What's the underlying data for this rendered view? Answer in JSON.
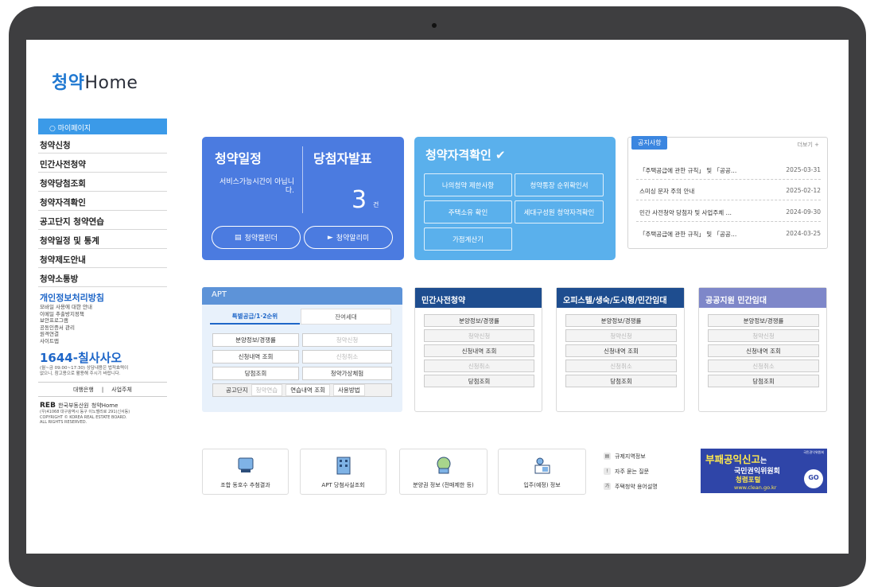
{
  "logo": {
    "prefix": "청약",
    "suffix": "Home"
  },
  "sidebar": {
    "mypage": "마이페이지",
    "items": [
      "청약신청",
      "민간사전청약",
      "청약당첨조회",
      "청약자격확인",
      "공고단지 청약연습",
      "청약일정 및 통계",
      "청약제도안내",
      "청약소통방"
    ],
    "privacy_title": "개인정보처리방침",
    "privacy_links": [
      "모바일 사용에 대한 안내",
      "이메일 추출방지정책",
      "보안프로그램",
      "공동인증서 관리",
      "원격연결",
      "사이트맵"
    ],
    "phone": "1644-칠사사오",
    "hours": [
      "(월~금 09:00~17:30) 상담내용은 법적효력이",
      "없으니, 참고용으로 활용해 주시기 바랍니다."
    ],
    "links": [
      "대행은행",
      "사업주체"
    ],
    "org": "REB",
    "org_name": "한국부동산원",
    "copyright": [
      "(우)41068 대구광역시 동구 이노밸리로 291(신서동)",
      "COPYRIGHT © KOREA REAL ESTATE BOARD.",
      "ALL RIGHTS RESERVED."
    ]
  },
  "schedule": {
    "title": "청약일정",
    "winner_title": "당첨자발표",
    "message": "서비스가능시간이 아닙니다.",
    "count": "3",
    "count_unit": "건",
    "calendar_btn": "청약캘린더",
    "alarm_btn": "청약알리미"
  },
  "qualification": {
    "title": "청약자격확인",
    "buttons": [
      "나의청약 제한사항",
      "청약통장 순위확인서",
      "주택소유 확인",
      "세대구성원 청약자격확인",
      "가점계산기"
    ]
  },
  "notice": {
    "tag": "공지사항",
    "more": "더보기",
    "items": [
      {
        "title": "「주택공급에 관한 규칙」 및 「공공…",
        "date": "2025-03-31"
      },
      {
        "title": "스미싱 문자 주의 안내",
        "date": "2025-02-12"
      },
      {
        "title": "민간 사전청약 당첨자 및 사업주체 …",
        "date": "2024-09-30"
      },
      {
        "title": "「주택공급에 관한 규칙」 및 「공공…",
        "date": "2024-03-25"
      }
    ]
  },
  "apt": {
    "title": "APT",
    "tab_special": "특별공급/1·2순위",
    "tab_remain": "잔여세대",
    "buttons": [
      "분양정보/경쟁률",
      "청약신청",
      "신청내역 조회",
      "신청취소",
      "당첨조회",
      "청약가상체험"
    ],
    "practice_label": "공고단지",
    "practice_buttons": [
      "청약연습",
      "연습내역 조회",
      "사용방법"
    ]
  },
  "panels": [
    {
      "title": "민간사전청약",
      "color": "#1e4d8f",
      "buttons": [
        "분양정보/경쟁률",
        "청약신청",
        "신청내역 조회",
        "신청취소",
        "당첨조회"
      ]
    },
    {
      "title": "오피스텔/생숙/도시형/민간임대",
      "color": "#1e4d8f",
      "buttons": [
        "분양정보/경쟁률",
        "청약신청",
        "신청내역 조회",
        "신청취소",
        "당첨조회"
      ]
    },
    {
      "title": "공공지원 민간임대",
      "color": "#7e87c9",
      "buttons": [
        "분양정보/경쟁률",
        "청약신청",
        "신청내역 조회",
        "신청취소",
        "당첨조회"
      ]
    }
  ],
  "quick_links": [
    {
      "label": "조합 동호수 추첨결과",
      "icon": "lottery-icon"
    },
    {
      "label": "APT 당첨사실조회",
      "icon": "building-icon"
    },
    {
      "label": "분양권 정보 (전매제한 등)",
      "icon": "document-icon"
    },
    {
      "label": "입주(예정) 정보",
      "icon": "resident-icon"
    }
  ],
  "side_links": [
    {
      "label": "규제지역정보",
      "icon": "map-icon"
    },
    {
      "label": "자주 묻는 질문",
      "icon": "faq-icon"
    },
    {
      "label": "주택청약 용어설명",
      "icon": "glossary-icon"
    }
  ],
  "banner": {
    "line1": "부패공익신고",
    "line1_suffix": "는",
    "line2": "국민권익위원회",
    "line3": "청렴포털",
    "url": "www.clean.go.kr",
    "go": "GO",
    "badge": "국민권익위원회"
  }
}
